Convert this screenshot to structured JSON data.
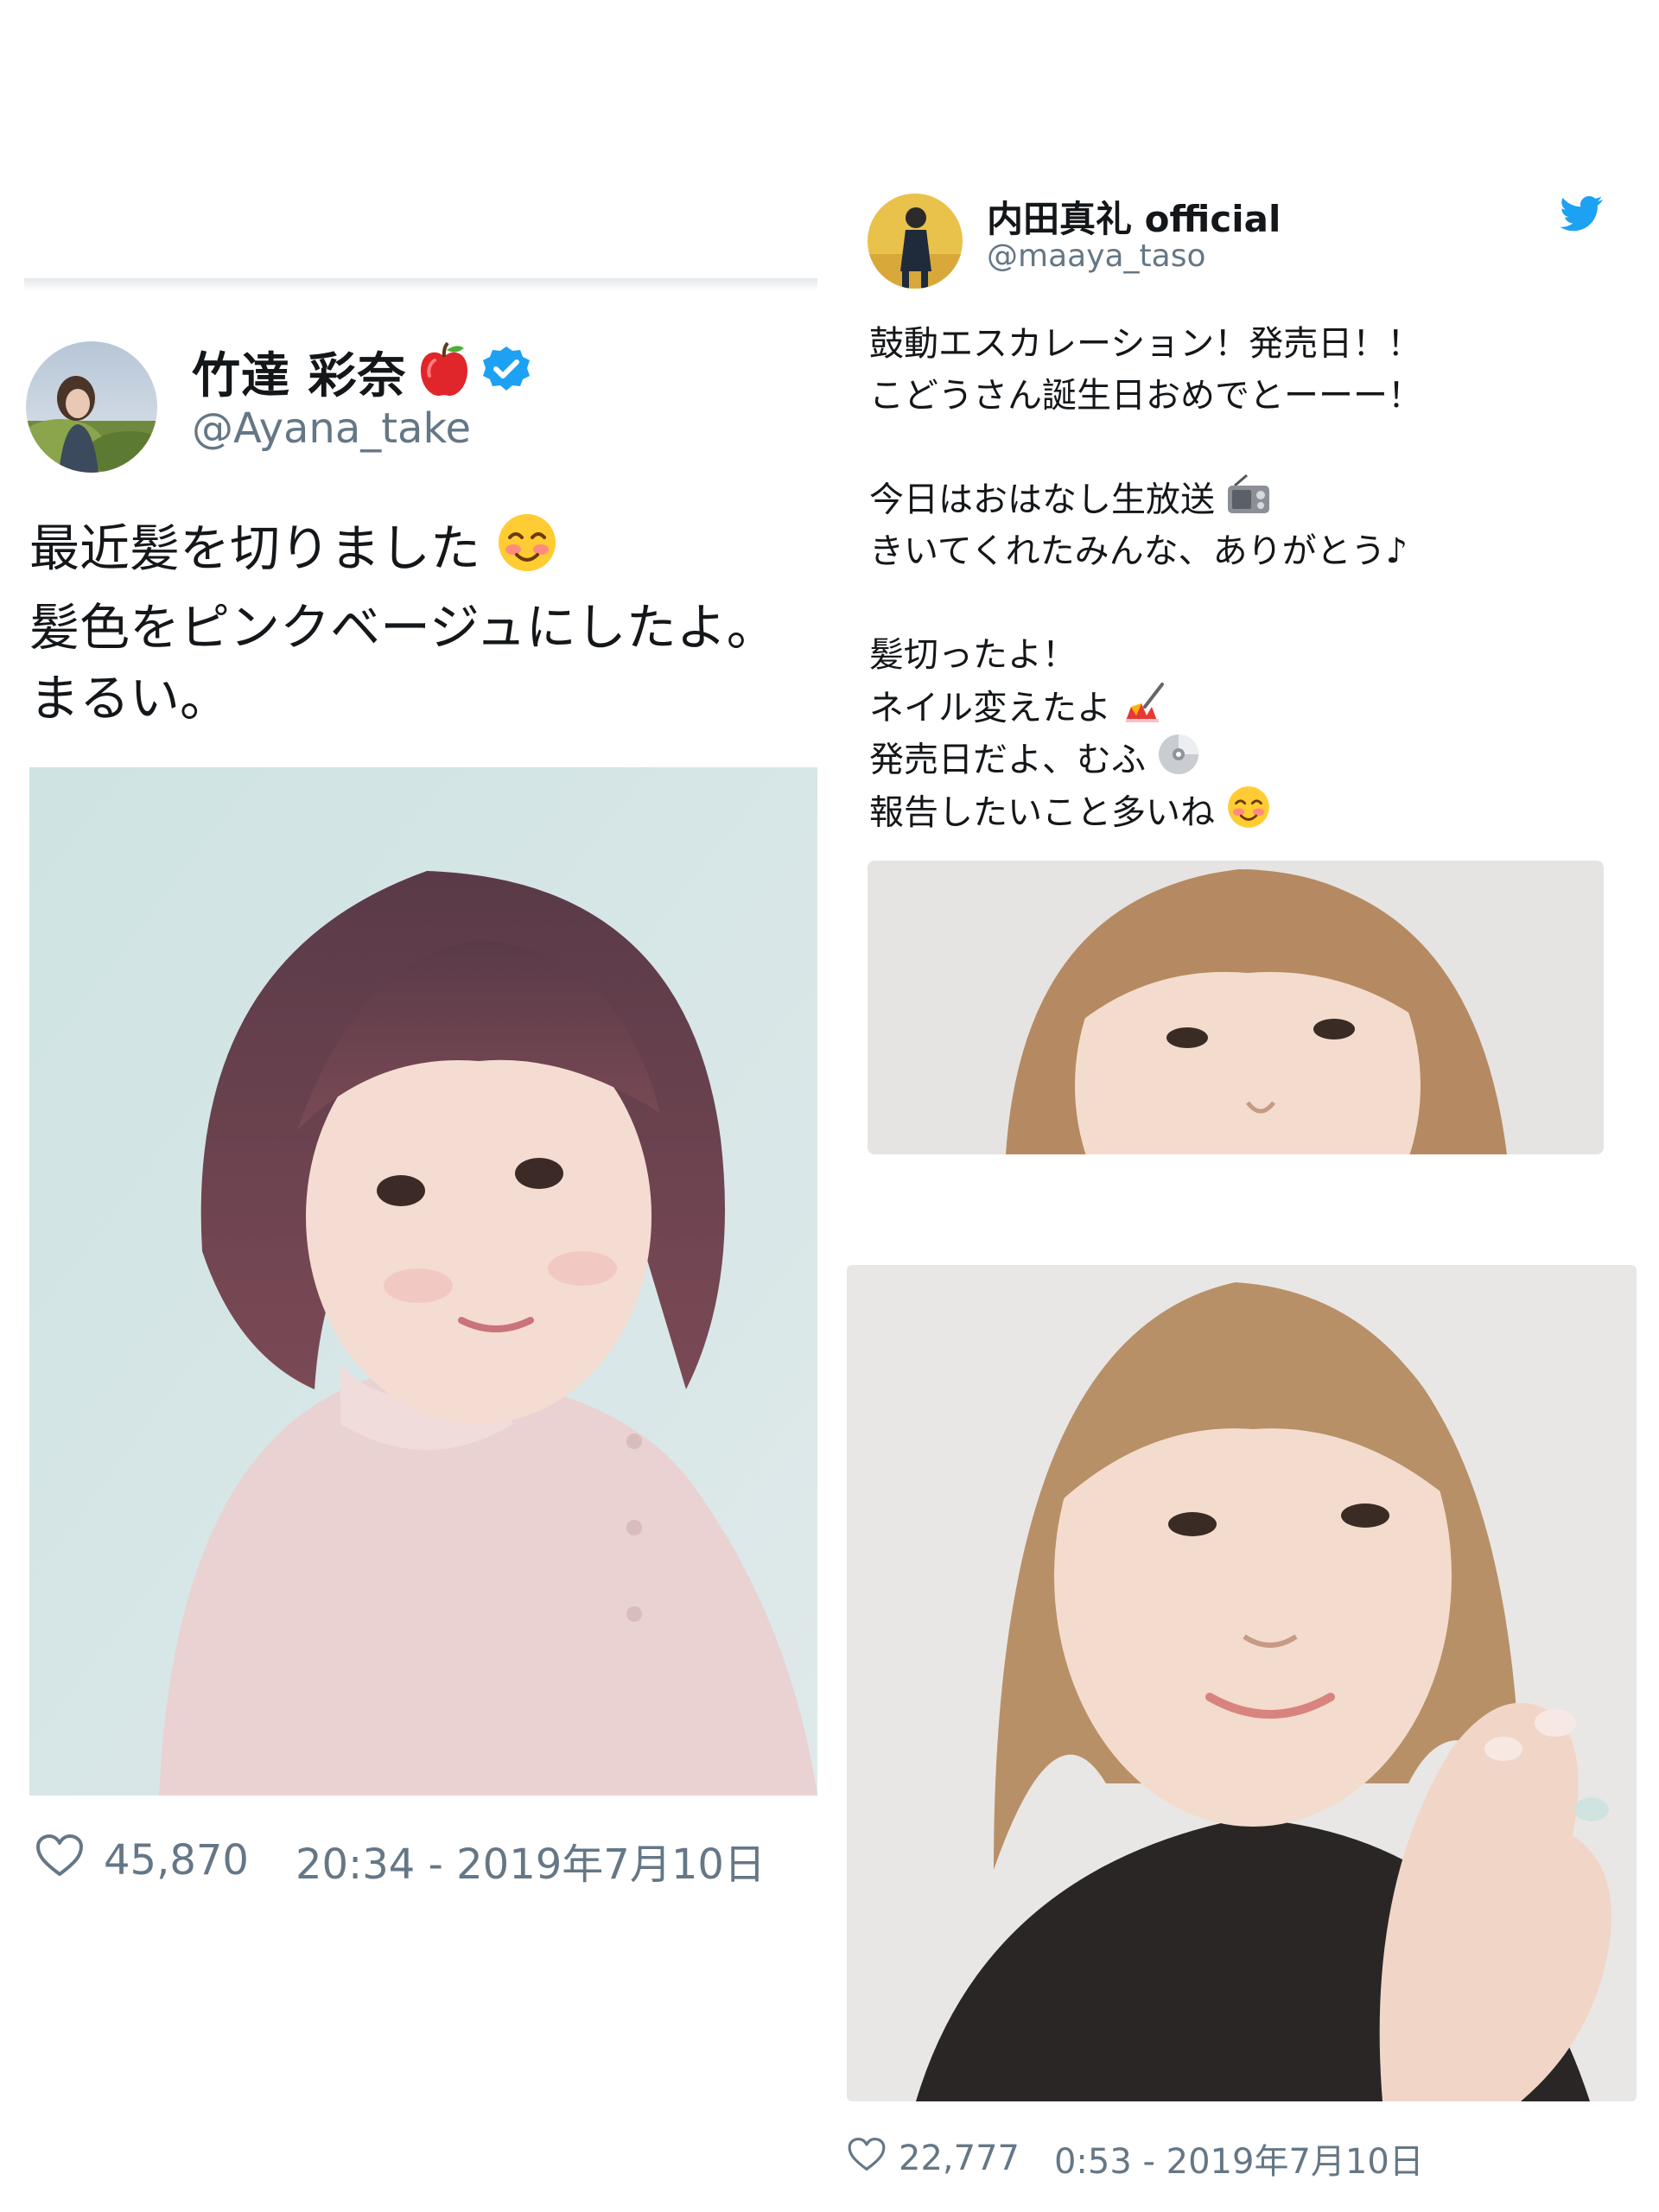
{
  "left_tweet": {
    "display_name": "竹達 彩奈",
    "handle": "@Ayana_take",
    "verified": true,
    "name_emoji_icon": "red-apple-icon",
    "text_lines": [
      "最近髪を切りました",
      "髪色をピンクベージュにしたよ。",
      "まるい。"
    ],
    "line1_emoji_icon": "smiling-blushing-face-icon",
    "likes": "45,870",
    "timestamp": "20:34 - 2019年7月10日"
  },
  "right_tweet": {
    "display_name": "内田真礼 official",
    "handle": "@maaya_taso",
    "brand_icon": "twitter-bird-icon",
    "text_lines": [
      "鼓動エスカレーション！発売日！！",
      "こどうさん誕生日おめでとーーー！",
      "",
      "今日はおはなし生放送",
      "きいてくれたみんな、ありがとう♪",
      "",
      "髪切ったよ！",
      "ネイル変えたよ",
      "発売日だよ、むふ",
      "報告したいこと多いね"
    ],
    "line_emoji_icons": {
      "3": "radio-icon",
      "7": "nail-polish-icon",
      "8": "dvd-disc-icon",
      "9": "smiling-blushing-face-icon"
    },
    "likes": "22,777",
    "timestamp": "0:53 - 2019年7月10日"
  },
  "colors": {
    "text": "#14171a",
    "secondary": "#657786",
    "verified_blue": "#1da1f2",
    "twitter_blue": "#1da1f2"
  }
}
